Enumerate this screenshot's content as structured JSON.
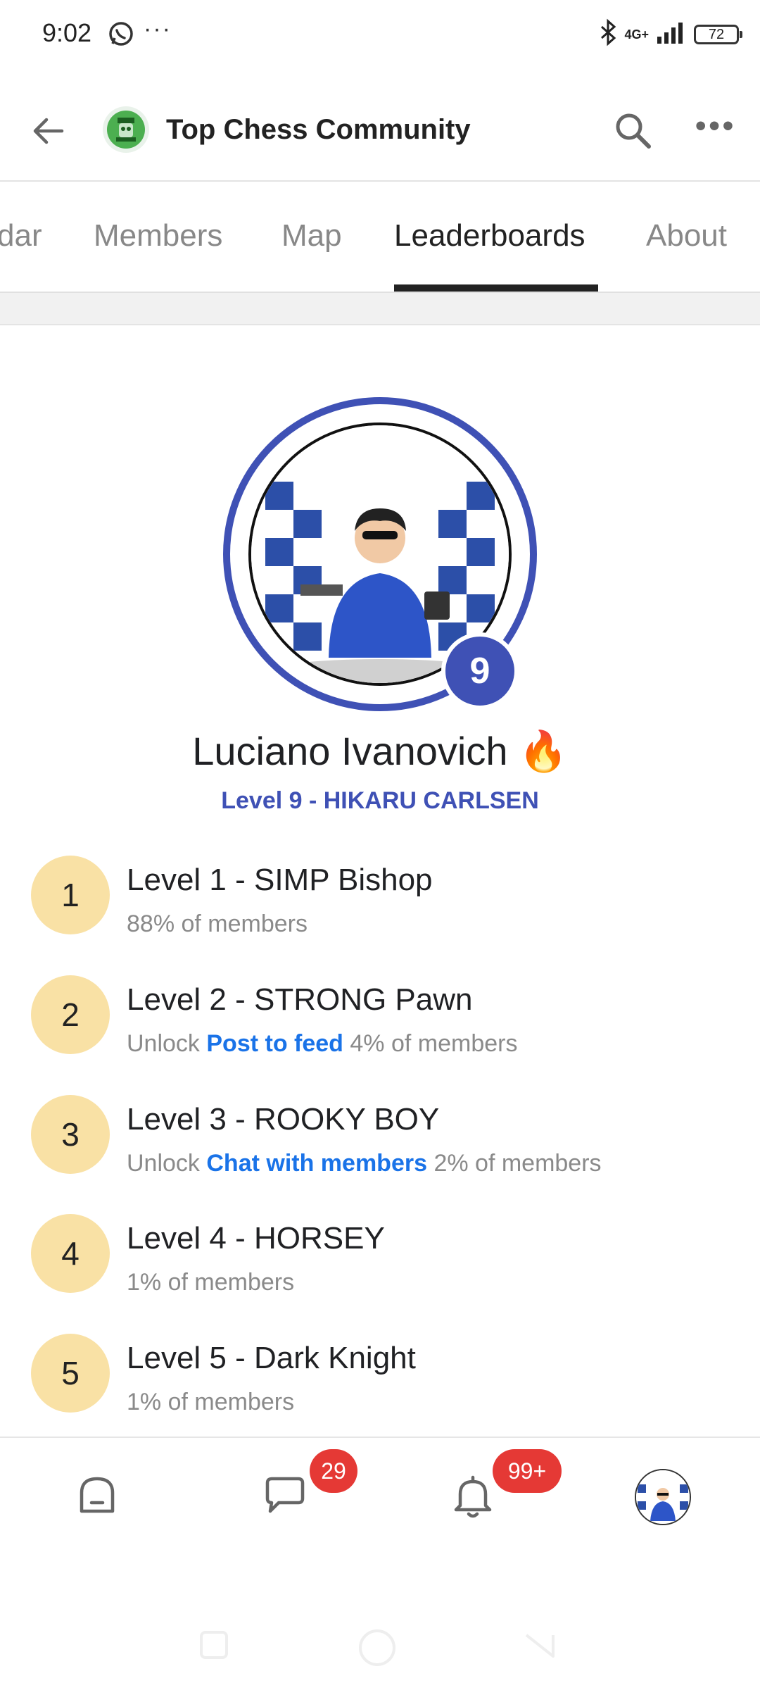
{
  "status_bar": {
    "time": "9:02",
    "network": "4G+",
    "battery": "72"
  },
  "app_bar": {
    "title": "Top Chess Community"
  },
  "tabs": [
    {
      "label": "dar"
    },
    {
      "label": "Members"
    },
    {
      "label": "Map"
    },
    {
      "label": "Leaderboards",
      "active": true
    },
    {
      "label": "About"
    }
  ],
  "profile": {
    "avatar_caption": "Luciano Ivanovich",
    "level_number": "9",
    "name": "Luciano Ivanovich 🔥",
    "level_text": "Level 9 - HIKARU CARLSEN",
    "accent_color": "#3f51b5"
  },
  "levels": [
    {
      "number": "1",
      "title": "Level 1 - SIMP Bishop",
      "prefix": "",
      "unlock": "",
      "members": "88% of members"
    },
    {
      "number": "2",
      "title": "Level 2 - STRONG Pawn",
      "prefix": "Unlock ",
      "unlock": "Post to feed",
      "members": " 4% of members"
    },
    {
      "number": "3",
      "title": "Level 3 - ROOKY BOY",
      "prefix": "Unlock ",
      "unlock": "Chat with members",
      "members": " 2% of members"
    },
    {
      "number": "4",
      "title": "Level 4 - HORSEY",
      "prefix": "",
      "unlock": "",
      "members": "1% of members"
    },
    {
      "number": "5",
      "title": "Level 5 - Dark Knight",
      "prefix": "",
      "unlock": "",
      "members": "1% of members"
    }
  ],
  "bottom_nav": {
    "chat_badge": "29",
    "notifications_badge": "99+"
  }
}
